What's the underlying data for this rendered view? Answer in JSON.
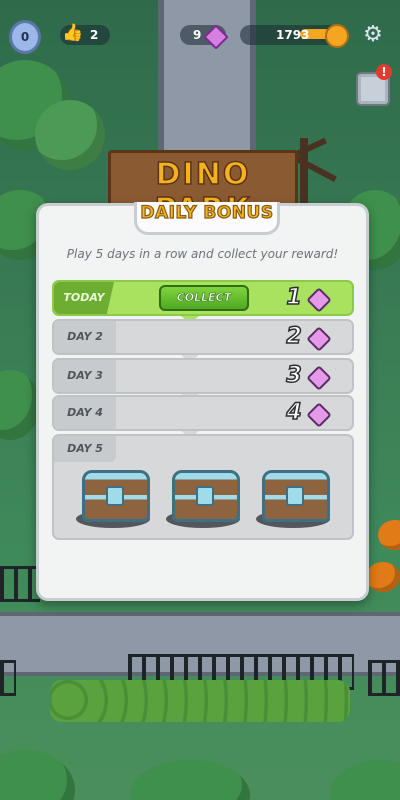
{
  "hud": {
    "level": "0",
    "likes": "2",
    "gems": "9",
    "coins": "1793",
    "alert_badge": "!"
  },
  "background": {
    "sign_text": "DINO PARK"
  },
  "daily_bonus": {
    "title": "DAILY BONUS",
    "subtitle": "Play 5 days in a row and collect your reward!",
    "rows": [
      {
        "label": "TODAY",
        "reward": "1",
        "button": "COLLECT"
      },
      {
        "label": "DAY 2",
        "reward": "2"
      },
      {
        "label": "DAY 3",
        "reward": "3"
      },
      {
        "label": "DAY 4",
        "reward": "4"
      },
      {
        "label": "DAY 5"
      }
    ]
  },
  "colors": {
    "today_row": "#a8e25e",
    "title_gold": "#f1b620",
    "gem_pink": "#e59ae9"
  }
}
